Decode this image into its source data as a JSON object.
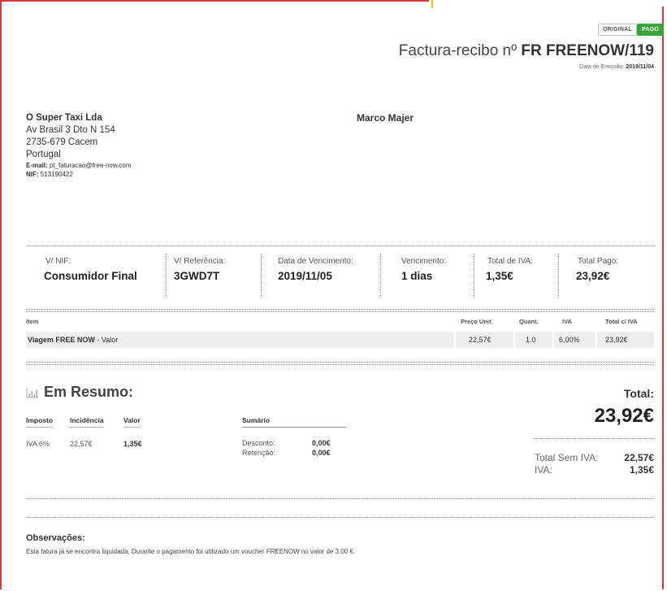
{
  "badges": {
    "original": "ORIGINAL",
    "pago": "PAGO"
  },
  "colors": {
    "pago_badge": "#3aa53a",
    "frame_border": "#d83a3a",
    "row_background": "#eeeeee"
  },
  "header": {
    "title_prefix": "Factura-recibo nº ",
    "title_number": "FR FREENOW/119",
    "emission_label": "Data de Emissão: ",
    "emission_date": "2019/11/04"
  },
  "issuer": {
    "name": "O Super Taxi Lda",
    "address1": "Av Brasil 3 Dto N 154",
    "address2": "2735-679 Cacem",
    "country": "Portugal",
    "email_label": "E-mail:",
    "email": " pt_faturacao@free-now.com",
    "nif_label": "NIF:",
    "nif": " 513190422"
  },
  "client": {
    "name": "Marco Majer"
  },
  "summary": [
    {
      "label": "V/ NIF:",
      "value": "Consumidor Final"
    },
    {
      "label": "V/ Referência:",
      "value": "3GWD7T"
    },
    {
      "label": "Data de Vencimento:",
      "value": "2019/11/05"
    },
    {
      "label": "Vencimento:",
      "value": "1 dias"
    },
    {
      "label": "Total de IVA:",
      "value": "1,35€"
    },
    {
      "label": "Total Pago:",
      "value": "23,92€"
    }
  ],
  "items_table": {
    "headers": {
      "item": "Item",
      "unit_price": "Preço Unit.",
      "qty": "Quant.",
      "vat": "IVA",
      "total": "Total c/ IVA"
    },
    "rows": [
      {
        "item_bold": "Viagem FREE NOW",
        "item_rest": " - Valor",
        "unit_price": "22,57€",
        "qty": "1.0",
        "vat": "6,00%",
        "total": "23,92€"
      }
    ]
  },
  "resumo": {
    "title": "Em Resumo:",
    "icon": "bar-chart-icon",
    "tax_headers": {
      "tax": "Imposto",
      "base": "Incidência",
      "value": "Valor"
    },
    "tax_rows": [
      {
        "tax": "IVA 6%",
        "base": "22,57€",
        "value": "1,35€"
      }
    ],
    "sumario": {
      "title": "Sumário",
      "rows": [
        {
          "label": "Desconto:",
          "value": "0,00€"
        },
        {
          "label": "Retenção:",
          "value": "0,00€"
        }
      ]
    },
    "total_label": "Total:",
    "total_value": "23,92€",
    "sem_iva_label": "Total Sem IVA:",
    "sem_iva_value": "22,57€",
    "iva_label": "IVA:",
    "iva_value": "1,35€"
  },
  "observations": {
    "title": "Observações:",
    "text": "Esta fatura já se encontra liquidada. Durante o pagamento foi utilizado um voucher FREENOW no valor de 3.00 €."
  }
}
